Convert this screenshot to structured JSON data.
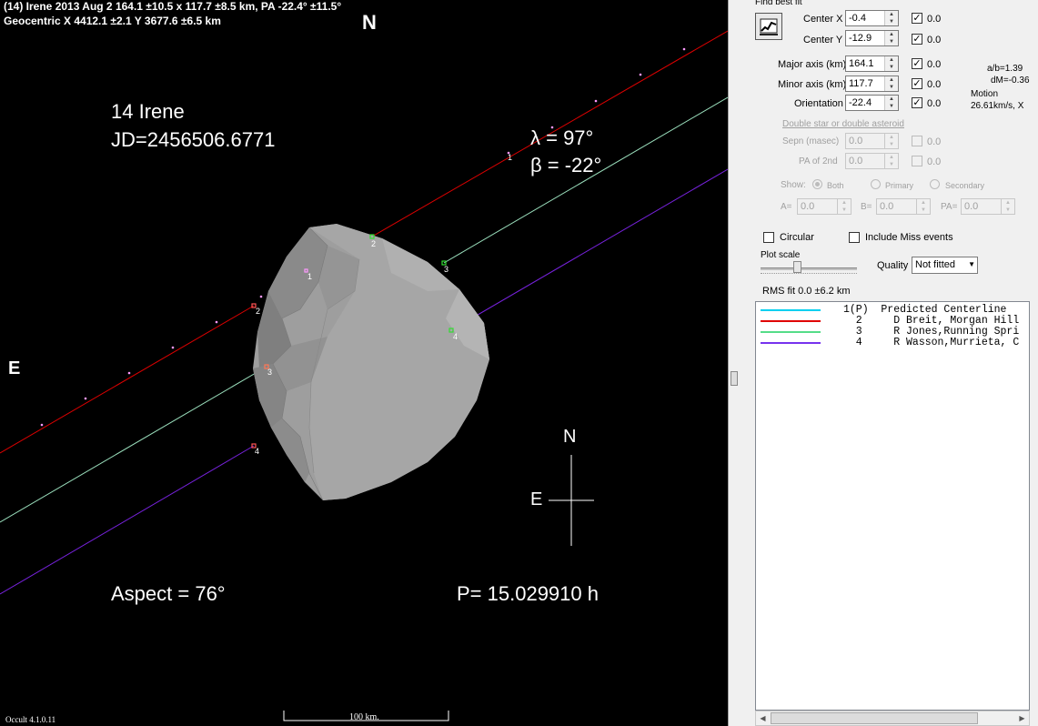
{
  "plot": {
    "header_line1": "(14) Irene  2013 Aug 2   164.1 ±10.5 x 117.7 ±8.5 km, PA -22.4° ±11.5°",
    "header_line2": "Geocentric  X  4412.1 ±2.1   Y 3677.6 ±6.5 km",
    "north_top": "N",
    "east_left": "E",
    "asteroid_name": "14 Irene",
    "jd": "JD=2456506.6771",
    "lambda": "λ =  97°",
    "beta": "β =  -22°",
    "aspect": "Aspect = 76°",
    "period": "P= 15.029910 h",
    "compass_n": "N",
    "compass_e": "E",
    "scale_label": "100 km.",
    "version": "Occult 4.1.0.11",
    "chord_labels": [
      "1",
      "2",
      "3",
      "4",
      "2",
      "3",
      "4",
      "1"
    ],
    "colors": {
      "chord1": "#ffaaff",
      "chord2": "#dd0000",
      "chord3": "#99ddbb",
      "chord4": "#7722dd",
      "shape": "#a8a8a8"
    }
  },
  "panel": {
    "title": "Find best fit",
    "center_x": {
      "label": "Center X",
      "value": "-0.4",
      "unc": "0.0"
    },
    "center_y": {
      "label": "Center Y",
      "value": "-12.9",
      "unc": "0.0"
    },
    "major": {
      "label": "Major axis (km)",
      "value": "164.1",
      "unc": "0.0"
    },
    "minor": {
      "label": "Minor axis (km)",
      "value": "117.7",
      "unc": "0.0"
    },
    "orient": {
      "label": "Orientation",
      "value": "-22.4",
      "unc": "0.0"
    },
    "ab_ratio": "a/b=1.39",
    "dm": "dM=-0.36",
    "motion_label": "Motion",
    "motion_value": "26.61km/s, X",
    "double_star": "Double star  or  double asteroid",
    "sepn": {
      "label": "Sepn (masec)",
      "value": "0.0",
      "unc": "0.0"
    },
    "pa2": {
      "label": "PA of 2nd",
      "value": "0.0",
      "unc": "0.0"
    },
    "show_label": "Show:",
    "show_options": [
      "Both",
      "Primary",
      "Secondary"
    ],
    "a_label": "A=",
    "a_value": "0.0",
    "b_label": "B=",
    "b_value": "0.0",
    "pa_label": "PA=",
    "pa_value": "0.0",
    "circular": "Circular",
    "include_miss": "Include Miss events",
    "plot_scale": "Plot scale",
    "quality_label": "Quality",
    "quality_value": "Not fitted",
    "rms": "RMS fit 0.0 ±6.2 km",
    "legend": [
      {
        "color": "#00d0f0",
        "text": "1(P)  Predicted Centerline"
      },
      {
        "color": "#e00000",
        "text": "  2     D Breit, Morgan Hill"
      },
      {
        "color": "#55dd88",
        "text": "  3     R Jones,Running Spri"
      },
      {
        "color": "#7733ee",
        "text": "  4     R Wasson,Murrieta, C"
      }
    ]
  }
}
